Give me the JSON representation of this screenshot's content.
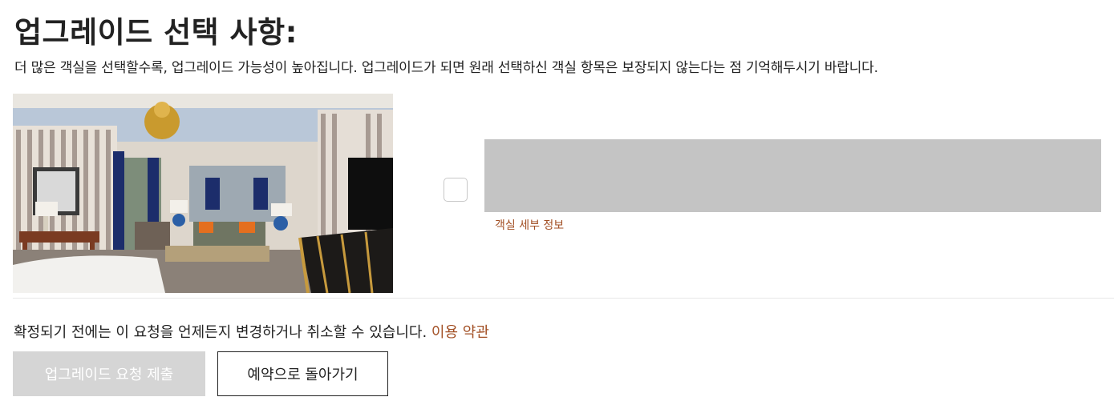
{
  "header": {
    "title": "업그레이드 선택 사항:",
    "subtitle": "더 많은 객실을 선택할수록, 업그레이드 가능성이 높아집니다. 업그레이드가 되면 원래 선택하신 객실 항목은 보장되지 않는다는 점 기억해두시기 바랍니다."
  },
  "room": {
    "checked": false,
    "details_link": "객실 세부 정보"
  },
  "footer": {
    "notice": "확정되기 전에는 이 요청을 언제든지 변경하거나 취소할 수 있습니다.",
    "terms_link": "이용 약관",
    "submit_label": "업그레이드 요청 제출",
    "back_label": "예약으로 돌아가기"
  },
  "colors": {
    "link": "#a24f24",
    "submit_disabled_bg": "#d5d5d5",
    "placeholder": "#c4c4c4"
  }
}
